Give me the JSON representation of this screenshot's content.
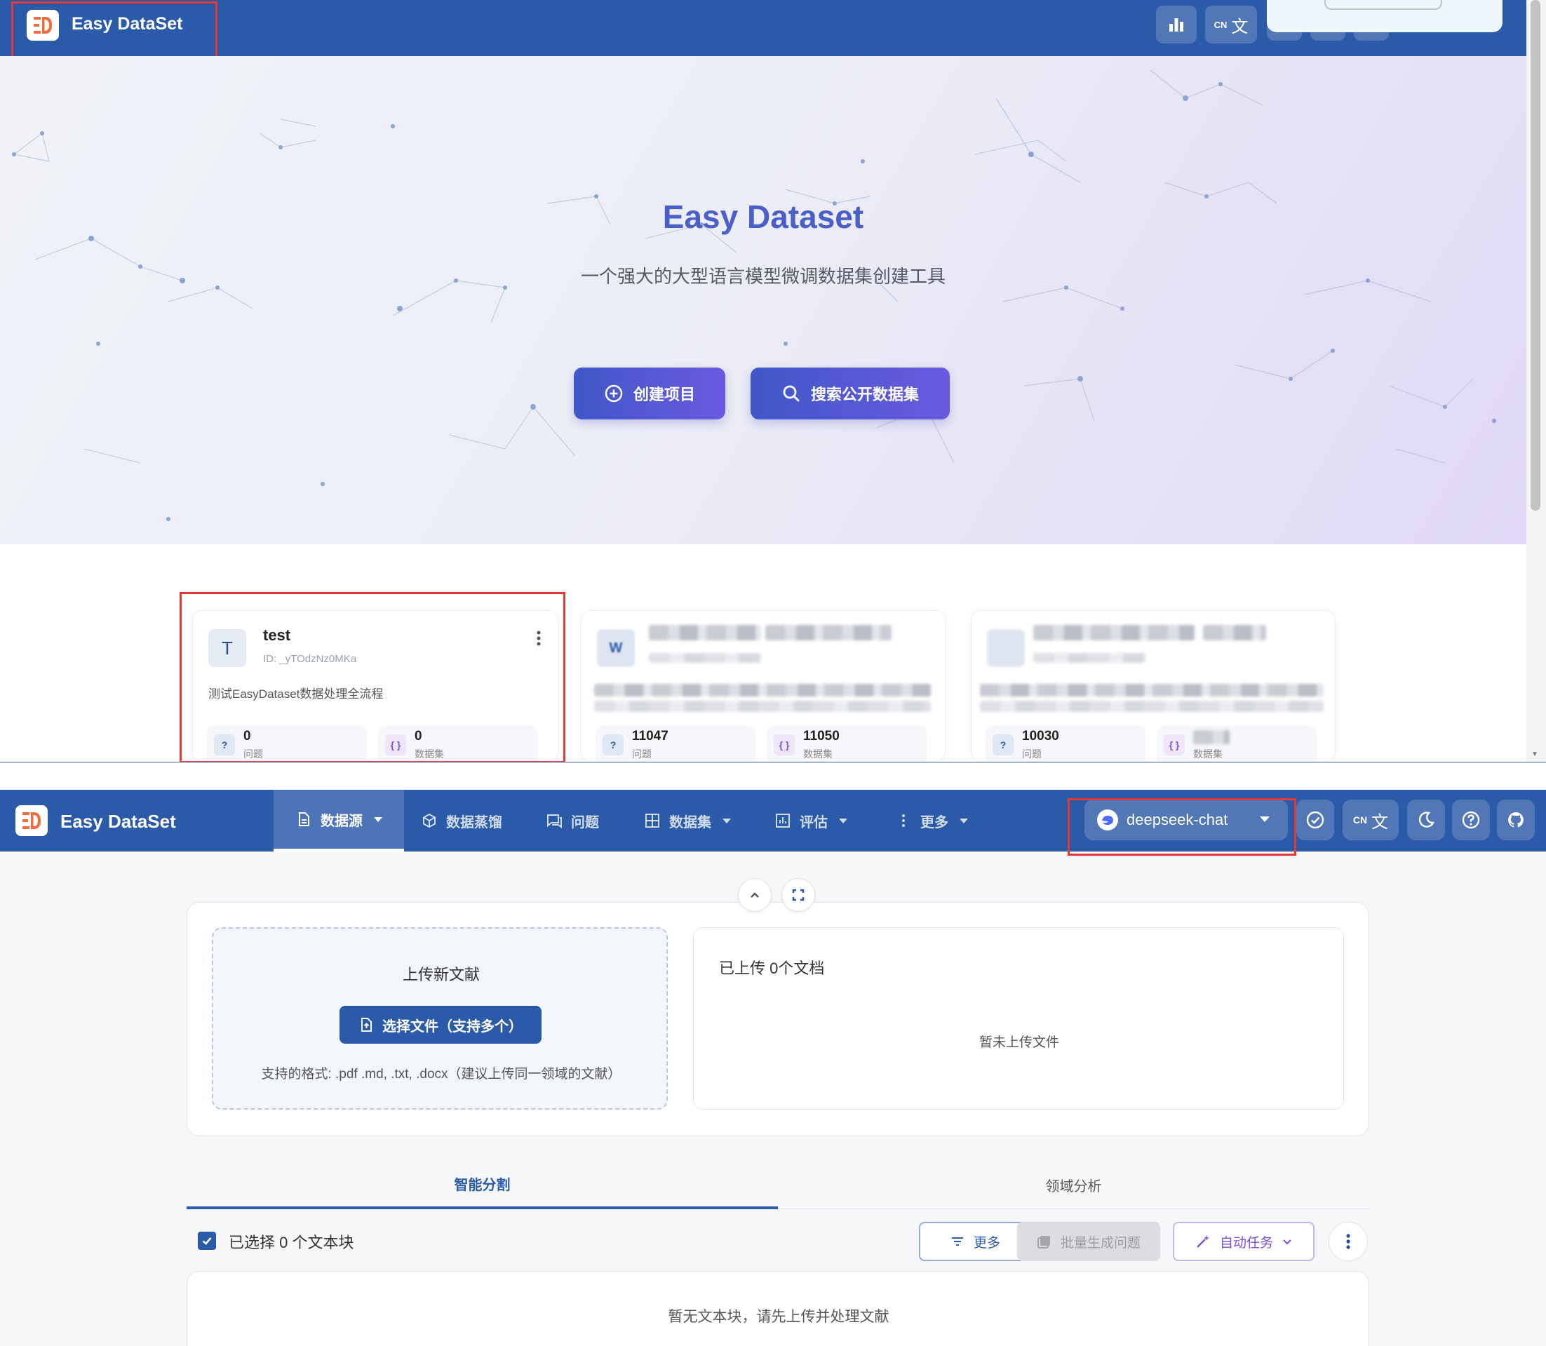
{
  "top": {
    "brand": "Easy DataSet",
    "header_buttons": [
      {
        "icon": "bar-chart-icon"
      },
      {
        "icon": "translate-icon",
        "label": "CN"
      }
    ],
    "hero": {
      "title": "Easy Dataset",
      "subtitle": "一个强大的大型语言模型微调数据集创建工具",
      "create_button": "创建项目",
      "search_button": "搜索公开数据集"
    },
    "projects": [
      {
        "avatar": "T",
        "name": "test",
        "id": "ID: _yTOdzNz0MKa",
        "description": "测试EasyDataset数据处理全流程",
        "questions": "0",
        "questions_label": "问题",
        "datasets": "0",
        "datasets_label": "数据集"
      },
      {
        "avatar": "W",
        "questions": "11047",
        "questions_label": "问题",
        "datasets": "11050",
        "datasets_label": "数据集"
      },
      {
        "questions": "10030",
        "questions_label": "问题",
        "datasets_label": "数据集"
      }
    ]
  },
  "bottom": {
    "brand": "Easy DataSet",
    "nav": [
      {
        "label": "数据源",
        "icon": "file-icon",
        "active": true,
        "dropdown": true
      },
      {
        "label": "数据蒸馏",
        "icon": "cube-icon",
        "active": false,
        "dropdown": false
      },
      {
        "label": "问题",
        "icon": "chat-icon",
        "active": false,
        "dropdown": false
      },
      {
        "label": "数据集",
        "icon": "grid-icon",
        "active": false,
        "dropdown": true
      },
      {
        "label": "评估",
        "icon": "chart-icon",
        "active": false,
        "dropdown": true
      },
      {
        "label": "更多",
        "icon": "more-vertical-icon",
        "active": false,
        "dropdown": true
      }
    ],
    "model": "deepseek-chat",
    "lang": "CN",
    "upload": {
      "title": "上传新文献",
      "button": "选择文件（支持多个）",
      "hint": "支持的格式: .pdf .md, .txt, .docx（建议上传同一领域的文献）"
    },
    "uploaded": {
      "title": "已上传 0个文档",
      "empty": "暂未上传文件"
    },
    "tabs": [
      "智能分割",
      "领域分析"
    ],
    "selection": "已选择 0 个文本块",
    "toolbar": {
      "more": "更多",
      "batch": "批量生成问题",
      "auto": "自动任务"
    },
    "chunks_empty": "暂无文本块，请先上传并处理文献"
  },
  "colors": {
    "header": "#2b5aa8",
    "accent_purple": "#6a5ae0",
    "highlight_red": "#e53935"
  }
}
